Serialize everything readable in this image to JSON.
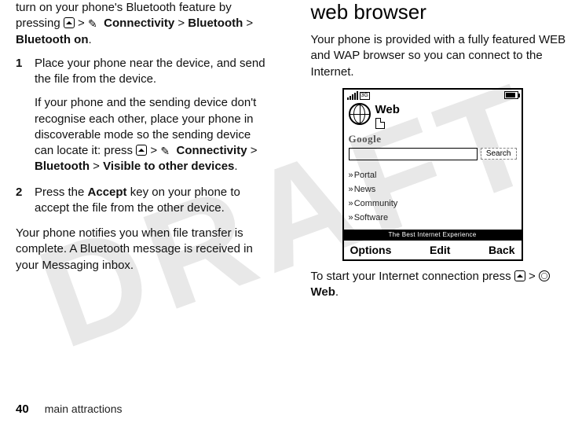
{
  "watermark": "DRAFT",
  "left": {
    "intro_pre": "turn on your phone's Bluetooth feature by pressing ",
    "nav1_a": "Connectivity",
    "nav1_b": "Bluetooth",
    "nav1_c": "Bluetooth on",
    "step1_num": "1",
    "step1_p1": "Place your phone near the device, and send the file from the device.",
    "step1_p2_pre": "If your phone and the sending device don't recognise each other, place your phone in discoverable mode so the sending device can locate it: press ",
    "step1_nav_a": "Connectivity",
    "step1_nav_b": "Bluetooth",
    "step1_nav_c": "Visible to other devices",
    "step2_num": "2",
    "step2_pre": "Press the ",
    "step2_key": "Accept",
    "step2_post": " key on your phone to accept the file from the other device.",
    "outro": "Your phone notifies you when file transfer is complete. A Bluetooth message is received in your Messaging inbox."
  },
  "right": {
    "heading": "web browser",
    "intro": "Your phone is provided with a fully featured WEB and WAP browser so you can connect to the Internet.",
    "outro_pre": "To start your Internet connection press ",
    "outro_label": "Web"
  },
  "phone": {
    "net": "3G",
    "title": "Web",
    "logo": "Google",
    "search_btn": "Search",
    "links": [
      "Portal",
      "News",
      "Community",
      "Software"
    ],
    "banner": "The Best Internet Experience",
    "sk_left": "Options",
    "sk_mid": "Edit",
    "sk_right": "Back"
  },
  "footer": {
    "page": "40",
    "chapter": "main attractions"
  }
}
